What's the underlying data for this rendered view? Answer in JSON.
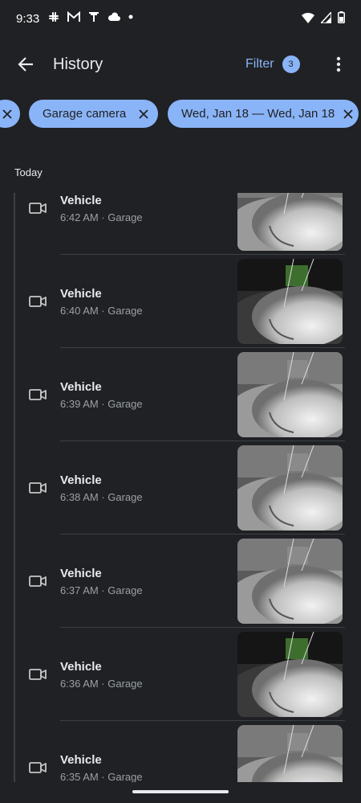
{
  "status_bar": {
    "time": "9:33",
    "icons": [
      "slack-icon",
      "gmail-icon",
      "tesla-icon",
      "cloud-icon",
      "dot-icon"
    ],
    "right_icons": [
      "wifi-icon",
      "signal-icon",
      "battery-icon"
    ]
  },
  "app_bar": {
    "title": "History",
    "filter_label": "Filter",
    "filter_count": "3"
  },
  "chips": [
    {
      "label": "Garage camera"
    },
    {
      "label": "Wed, Jan 18 — Wed, Jan 18"
    }
  ],
  "section_header": "Today",
  "events": [
    {
      "title": "Vehicle",
      "subtitle": "6:42 AM · Garage"
    },
    {
      "title": "Vehicle",
      "subtitle": "6:40 AM · Garage"
    },
    {
      "title": "Vehicle",
      "subtitle": "6:39 AM · Garage"
    },
    {
      "title": "Vehicle",
      "subtitle": "6:38 AM · Garage"
    },
    {
      "title": "Vehicle",
      "subtitle": "6:37 AM · Garage"
    },
    {
      "title": "Vehicle",
      "subtitle": "6:36 AM · Garage"
    },
    {
      "title": "Vehicle",
      "subtitle": "6:35 AM · Garage"
    }
  ],
  "colors": {
    "background": "#202124",
    "accent": "#8ab4f8",
    "text_primary": "#e8eaed",
    "text_secondary": "#9aa0a6"
  }
}
